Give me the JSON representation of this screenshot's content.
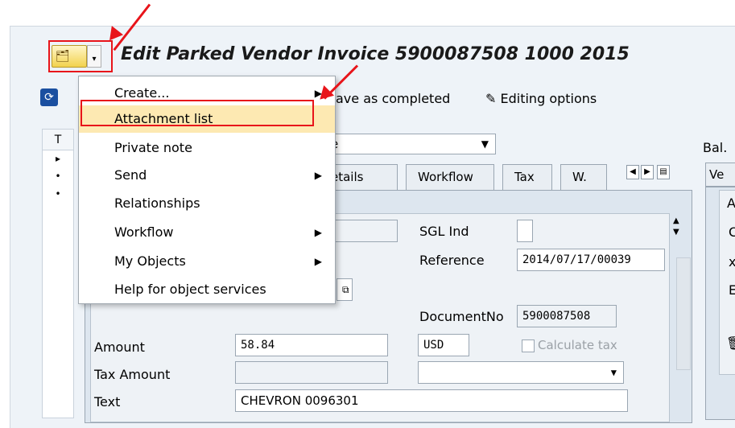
{
  "window": {
    "title": "Edit Parked Vendor Invoice 5900087508 1000 2015"
  },
  "toolbar": {
    "save_completed_label": "ave as completed",
    "editing_options_label": "Editing options"
  },
  "left_column": {
    "header": "T",
    "rows": [
      "▸",
      "•",
      "•"
    ]
  },
  "combo": {
    "value": "e"
  },
  "tabs": [
    {
      "label": "etails"
    },
    {
      "label": "Workflow"
    },
    {
      "label": "Tax"
    },
    {
      "label": "W."
    }
  ],
  "form": {
    "sgl_ind_label": "SGL Ind",
    "reference_label": "Reference",
    "reference_value": "2014/07/17/00039",
    "document_no_label": "DocumentNo",
    "document_no_value": "5900087508",
    "amount_label": "Amount",
    "amount_value": "58.84",
    "currency_value": "USD",
    "calculate_tax_label": "Calculate tax",
    "tax_amount_label": "Tax Amount",
    "text_label": "Text",
    "text_value": "CHEVRON 0096301"
  },
  "right_panel": {
    "bal_label": "Bal.",
    "ve_label": "Ve",
    "a_label": "A",
    "c_label": "C",
    "x_label": "x",
    "e_label": "E"
  },
  "menu": {
    "items": [
      {
        "label": "Create...",
        "submenu": true
      },
      {
        "label": "Attachment list",
        "submenu": false
      },
      {
        "label": "Private note",
        "submenu": false
      },
      {
        "label": "Send",
        "submenu": true
      },
      {
        "label": "Relationships",
        "submenu": false
      },
      {
        "label": "Workflow",
        "submenu": true
      },
      {
        "label": "My Objects",
        "submenu": true
      },
      {
        "label": "Help for object services",
        "submenu": false
      }
    ]
  },
  "colors": {
    "highlight_border": "#e8141a",
    "menu_highlight": "#fde9b2"
  }
}
